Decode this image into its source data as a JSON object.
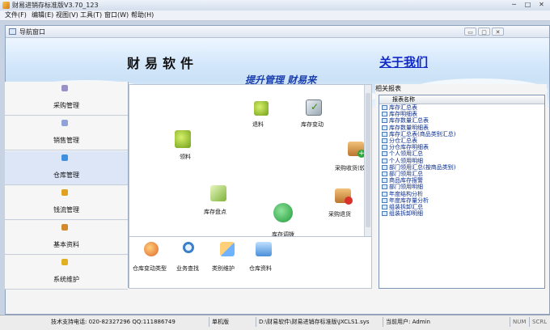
{
  "window": {
    "title": "财易进销存标准版V3.70_123",
    "buttons": {
      "minimize": "─",
      "maximize": "□",
      "close": "✕"
    }
  },
  "menubar": {
    "items": [
      "文件(F)",
      "编辑(E)",
      "视图(V)",
      "工具(T)",
      "窗口(W)",
      "帮助(H)"
    ]
  },
  "nav_window": {
    "title": "导航窗口",
    "buttons": {
      "minimize": "▭",
      "maximize": "▢",
      "close": "✕"
    }
  },
  "banner": {
    "title": "财易软件",
    "slogan": "提升管理 财易来",
    "about_link": "关于我们"
  },
  "nav": {
    "items": [
      {
        "label": "采购管理",
        "color": "#9b8fc9",
        "selected": false
      },
      {
        "label": "销售管理",
        "color": "#8ea4d8",
        "selected": false
      },
      {
        "label": "仓库管理",
        "color": "#3d8fe0",
        "selected": true
      },
      {
        "label": "钱流管理",
        "color": "#e0a020",
        "selected": false
      },
      {
        "label": "基本资料",
        "color": "#d48a2a",
        "selected": false
      },
      {
        "label": "系统维护",
        "color": "#e0b020",
        "selected": false
      }
    ]
  },
  "workspace": {
    "items": [
      {
        "label": "退料",
        "icon": "return-material-icon",
        "color": "#8fbf2a"
      },
      {
        "label": "库存变动",
        "icon": "stock-change-icon",
        "color": "#6a8f3a"
      },
      {
        "label": "领料",
        "icon": "pick-material-icon",
        "color": "#8fbf2a"
      },
      {
        "label": "采购收货(较",
        "icon": "purchase-receive-icon",
        "color": "#c9822e"
      },
      {
        "label": "库存盘点",
        "icon": "stock-count-icon",
        "color": "#7fb33a"
      },
      {
        "label": "采购退货",
        "icon": "purchase-return-icon",
        "color": "#c9462e"
      },
      {
        "label": "库存调拨",
        "icon": "stock-transfer-icon",
        "color": "#2fa84a"
      }
    ],
    "bottom_items": [
      {
        "label": "仓库变动类型",
        "icon": "change-type-icon",
        "color": "#e0642a"
      },
      {
        "label": "业务查找",
        "icon": "search-icon",
        "color": "#3a7fc9"
      },
      {
        "label": "类别维护",
        "icon": "category-icon",
        "color": "#e08a2a"
      },
      {
        "label": "仓库资料",
        "icon": "warehouse-icon",
        "color": "#4a8fd8"
      }
    ]
  },
  "reports": {
    "panel_title": "相关报表",
    "column_header": "报表名称",
    "rows": [
      "库存汇总表",
      "库存明细表",
      "库存数量汇总表",
      "库存数量明细表",
      "库存汇总表(商品类别汇总)",
      "分仓汇总表",
      "分仓库存明细表",
      "个人领用汇总",
      "个人领用明细",
      "部门领用汇总(按商品类别)",
      "部门领用汇总",
      "商品库存报警",
      "部门领用明细",
      "年度结构分析",
      "年度库存量分析",
      "组装拆卸汇总",
      "组装拆卸明细"
    ]
  },
  "statusbar": {
    "support": "技术支持电话: 020-82327296 QQ:111886749",
    "mode": "单机版",
    "path": "D:\\财易软件\\财易进销存标准版\\JXCLS1.sys",
    "user": "当前用户: Admin",
    "num": "NUM",
    "scrl": "SCRL"
  }
}
